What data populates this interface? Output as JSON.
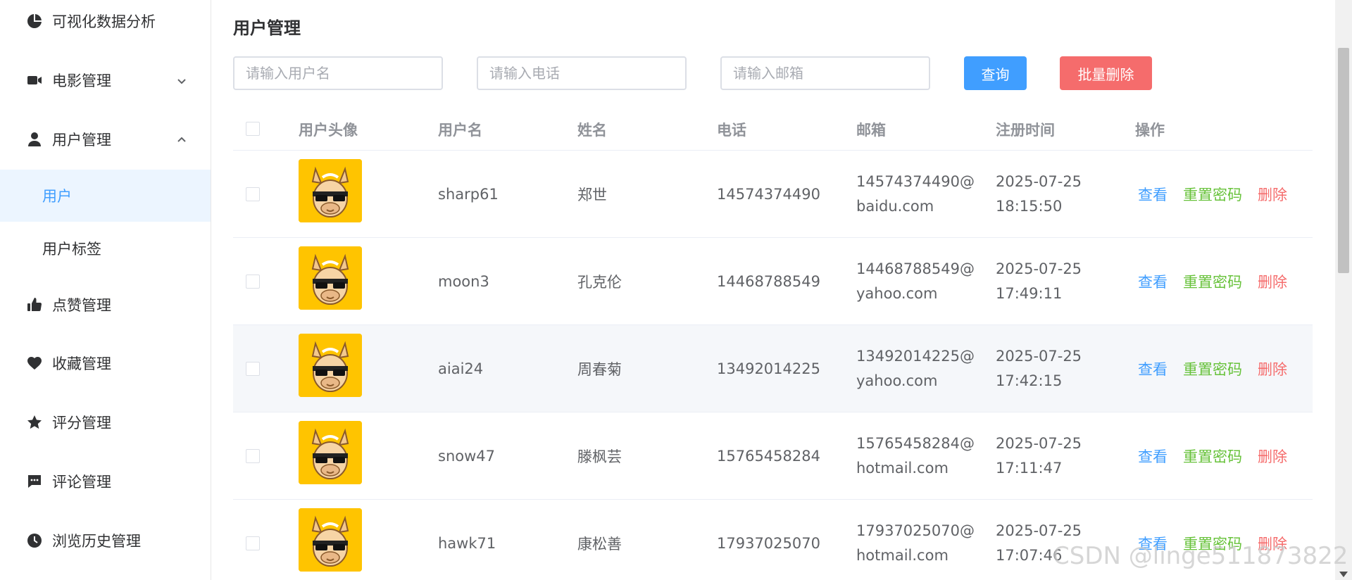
{
  "sidebar": {
    "items": [
      {
        "label": "可视化数据分析",
        "icon": "pie-chart-icon"
      },
      {
        "label": "电影管理",
        "icon": "video-camera-icon"
      },
      {
        "label": "用户管理",
        "icon": "user-icon"
      },
      {
        "label": "点赞管理",
        "icon": "thumbs-up-icon"
      },
      {
        "label": "收藏管理",
        "icon": "heart-icon"
      },
      {
        "label": "评分管理",
        "icon": "star-icon"
      },
      {
        "label": "评论管理",
        "icon": "comment-icon"
      },
      {
        "label": "浏览历史管理",
        "icon": "clock-icon"
      }
    ],
    "subitems": [
      {
        "label": "用户",
        "active": true
      },
      {
        "label": "用户标签",
        "active": false
      }
    ]
  },
  "main": {
    "title": "用户管理",
    "search": {
      "username_placeholder": "请输入用户名",
      "phone_placeholder": "请输入电话",
      "email_placeholder": "请输入邮箱",
      "query_label": "查询",
      "batch_delete_label": "批量删除"
    },
    "table": {
      "headers": [
        "用户头像",
        "用户名",
        "姓名",
        "电话",
        "邮箱",
        "注册时间",
        "操作"
      ],
      "actions": {
        "view": "查看",
        "reset": "重置密码",
        "delete": "删除"
      },
      "rows": [
        {
          "username": "sharp61",
          "name": "郑世",
          "phone": "14574374490",
          "email_1": "14574374490@",
          "email_2": "baidu.com",
          "date": "2025-07-25",
          "time": "18:15:50"
        },
        {
          "username": "moon3",
          "name": "孔克伦",
          "phone": "14468788549",
          "email_1": "14468788549@",
          "email_2": "yahoo.com",
          "date": "2025-07-25",
          "time": "17:49:11"
        },
        {
          "username": "aiai24",
          "name": "周春菊",
          "phone": "13492014225",
          "email_1": "13492014225@",
          "email_2": "yahoo.com",
          "date": "2025-07-25",
          "time": "17:42:15"
        },
        {
          "username": "snow47",
          "name": "滕枫芸",
          "phone": "15765458284",
          "email_1": "15765458284@",
          "email_2": "hotmail.com",
          "date": "2025-07-25",
          "time": "17:11:47"
        },
        {
          "username": "hawk71",
          "name": "康松善",
          "phone": "17937025070",
          "email_1": "17937025070@",
          "email_2": "hotmail.com",
          "date": "2025-07-25",
          "time": "17:07:46"
        }
      ]
    }
  },
  "watermark": "CSDN @linge511873822",
  "colors": {
    "primary": "#409eff",
    "success": "#67c23a",
    "danger": "#f56c6c",
    "active_bg": "#ecf5ff",
    "avatar_bg": "#ffc400"
  }
}
